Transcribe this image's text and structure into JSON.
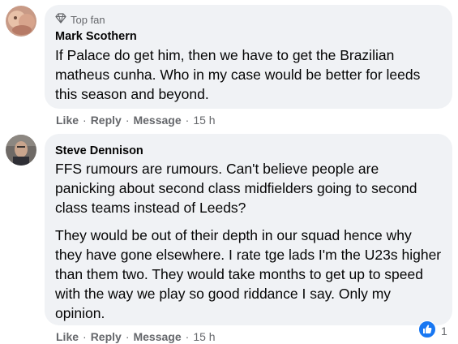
{
  "comments": [
    {
      "badge": "Top fan",
      "author": "Mark Scothern",
      "paragraphs": [
        "If Palace do get him, then we have to get the Brazilian matheus cunha. Who in my case would be better for leeds this season and beyond."
      ],
      "actions": {
        "like": "Like",
        "reply": "Reply",
        "message": "Message",
        "time": "15 h"
      }
    },
    {
      "author": "Steve Dennison",
      "paragraphs": [
        "FFS rumours are rumours. Can't believe people are panicking about second class midfielders going to second class teams instead of Leeds?",
        "They would be out of their depth in our squad hence why they have gone elsewhere. I rate tge lads I'm the U23s higher than them two. They would take months to get up to speed with the way we play so good riddance I say. Only my opinion."
      ],
      "actions": {
        "like": "Like",
        "reply": "Reply",
        "message": "Message",
        "time": "15 h"
      },
      "reaction": {
        "icon": "like-thumb-icon",
        "count": "1"
      }
    }
  ],
  "colors": {
    "bubble": "#f0f2f5",
    "like_blue": "#1877f2",
    "meta": "#65676b"
  }
}
